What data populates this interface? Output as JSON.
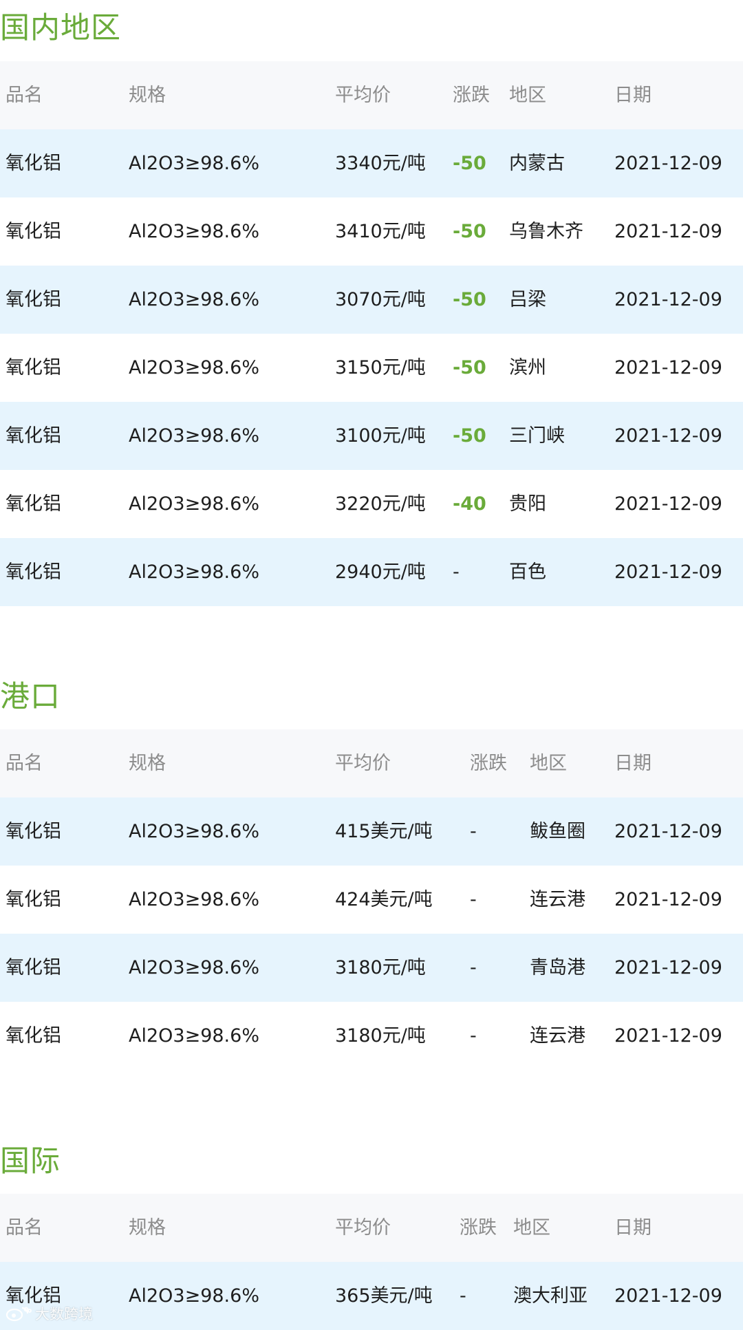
{
  "colors": {
    "title": "#6aab3a",
    "change_down": "#6aab3a",
    "header_bg": "#f7f8fa",
    "row_alt_bg": "#e6f4fd",
    "row_bg": "#ffffff"
  },
  "sections": [
    {
      "title": "国内地区",
      "headers": [
        "品名",
        "规格",
        "平均价",
        "涨跌",
        "地区",
        "日期"
      ],
      "rows": [
        {
          "name": "氧化铝",
          "spec": "Al2O3≥98.6%",
          "price": "3340元/吨",
          "change": "-50",
          "region": "内蒙古",
          "date": "2021-12-09"
        },
        {
          "name": "氧化铝",
          "spec": "Al2O3≥98.6%",
          "price": "3410元/吨",
          "change": "-50",
          "region": "乌鲁木齐",
          "date": "2021-12-09"
        },
        {
          "name": "氧化铝",
          "spec": "Al2O3≥98.6%",
          "price": "3070元/吨",
          "change": "-50",
          "region": "吕梁",
          "date": "2021-12-09"
        },
        {
          "name": "氧化铝",
          "spec": "Al2O3≥98.6%",
          "price": "3150元/吨",
          "change": "-50",
          "region": "滨州",
          "date": "2021-12-09"
        },
        {
          "name": "氧化铝",
          "spec": "Al2O3≥98.6%",
          "price": "3100元/吨",
          "change": "-50",
          "region": "三门峡",
          "date": "2021-12-09"
        },
        {
          "name": "氧化铝",
          "spec": "Al2O3≥98.6%",
          "price": "3220元/吨",
          "change": "-40",
          "region": "贵阳",
          "date": "2021-12-09"
        },
        {
          "name": "氧化铝",
          "spec": "Al2O3≥98.6%",
          "price": "2940元/吨",
          "change": "-",
          "region": "百色",
          "date": "2021-12-09"
        }
      ]
    },
    {
      "title": "港口",
      "headers": [
        "品名",
        "规格",
        "平均价",
        "涨跌",
        "地区",
        "日期"
      ],
      "rows": [
        {
          "name": "氧化铝",
          "spec": "Al2O3≥98.6%",
          "price": "415美元/吨",
          "change": "-",
          "region": "鲅鱼圈",
          "date": "2021-12-09"
        },
        {
          "name": "氧化铝",
          "spec": "Al2O3≥98.6%",
          "price": "424美元/吨",
          "change": "-",
          "region": "连云港",
          "date": "2021-12-09"
        },
        {
          "name": "氧化铝",
          "spec": "Al2O3≥98.6%",
          "price": "3180元/吨",
          "change": "-",
          "region": "青岛港",
          "date": "2021-12-09"
        },
        {
          "name": "氧化铝",
          "spec": "Al2O3≥98.6%",
          "price": "3180元/吨",
          "change": "-",
          "region": "连云港",
          "date": "2021-12-09"
        }
      ]
    },
    {
      "title": "国际",
      "headers": [
        "品名",
        "规格",
        "平均价",
        "涨跌",
        "地区",
        "日期"
      ],
      "rows": [
        {
          "name": "氧化铝",
          "spec": "Al2O3≥98.6%",
          "price": "365美元/吨",
          "change": "-",
          "region": "澳大利亚",
          "date": "2021-12-09"
        }
      ]
    }
  ],
  "watermark": {
    "icon": "weibo-logo-icon",
    "text": "大数跨境"
  }
}
